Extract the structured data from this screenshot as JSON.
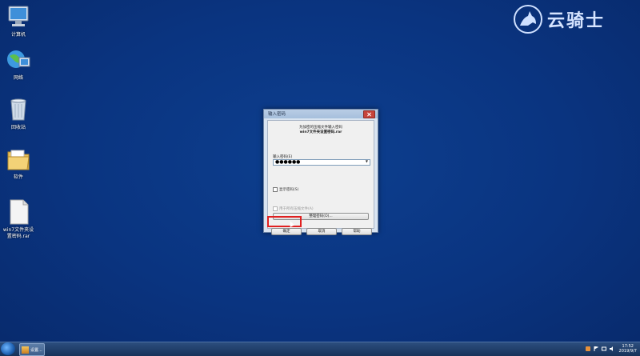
{
  "desktop": {
    "icons": [
      {
        "label": "计算机",
        "icon": "computer-icon"
      },
      {
        "label": "网络",
        "icon": "network-icon"
      },
      {
        "label": "回收站",
        "icon": "recycle-bin-icon"
      },
      {
        "label": "软件",
        "icon": "folder-icon"
      },
      {
        "label": "win7文件夹设置密码.rar",
        "icon": "rar-file-icon"
      }
    ]
  },
  "logo": {
    "text": "云骑士",
    "icon": "knight-logo-icon"
  },
  "dialog": {
    "title": "输入密码",
    "message_line1": "为加密的压缩文件输入密码",
    "message_line2": "win7文件夹设置密码.rar",
    "password_label": "输入密码(E)",
    "password_value": "●●●●●●",
    "show_password_label": "显示密码(S)",
    "use_all_label": "用于所有压缩文件(A)",
    "organize_button": "整理密码(O)...",
    "ok_button": "确定",
    "cancel_button": "取消",
    "help_button": "帮助"
  },
  "taskbar": {
    "app_label": "设置...",
    "clock_time": "17:52",
    "clock_date": "2019/9/7"
  },
  "colors": {
    "accent_red": "#e02020",
    "desktop_blue": "#0a3480"
  }
}
